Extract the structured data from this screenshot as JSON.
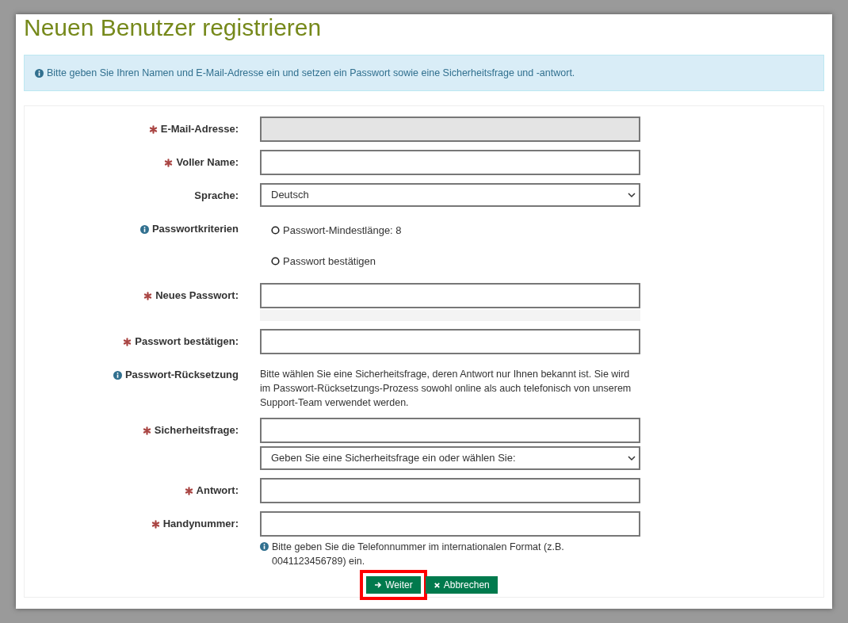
{
  "title": "Neuen Benutzer registrieren",
  "info": "Bitte geben Sie Ihren Namen und E-Mail-Adresse ein und setzen ein Passwort sowie eine Sicherheitsfrage und -antwort.",
  "fields": [
    {
      "kind": "input",
      "label": "E-Mail-Adresse:",
      "required": true,
      "disabled": true
    },
    {
      "kind": "input",
      "label": "Voller Name:",
      "required": true,
      "disabled": false
    },
    {
      "kind": "select",
      "label": "Sprache:",
      "required": false,
      "value": "Deutsch"
    },
    {
      "kind": "criteria",
      "label": "Passwortkriterien",
      "items": [
        {
          "text": "Passwort-Mindestlänge: 8",
          "checked": false
        },
        {
          "text": "Passwort bestätigen",
          "checked": false
        }
      ]
    },
    {
      "kind": "password",
      "label": "Neues Passwort:",
      "required": true,
      "disabled": false
    },
    {
      "kind": "input",
      "label": "Passwort bestätigen:",
      "required": true,
      "disabled": false
    },
    {
      "kind": "text",
      "label": "Passwort-Rücksetzung",
      "text": "Bitte wählen Sie eine Sicherheitsfrage, deren Antwort nur Ihnen bekannt ist. Sie wird im Passwort-Rücksetzungs-Prozess sowohl online als auch telefonisch von unserem Support-Team verwendet werden."
    },
    {
      "kind": "question",
      "label": "Sicherheitsfrage:",
      "required": true,
      "disabled": false,
      "select": "Geben Sie eine Sicherheitsfrage ein oder wählen Sie:"
    },
    {
      "kind": "input",
      "label": "Antwort:",
      "required": true,
      "disabled": false
    },
    {
      "kind": "hint",
      "label": "Handynummer:",
      "required": true,
      "disabled": false,
      "hint": "Bitte geben Sie die Telefonnummer im internationalen Format (z.B. 0041123456789) ein."
    }
  ],
  "buttons": [
    {
      "kind": "next",
      "label": "Weiter",
      "highlighted": true
    },
    {
      "kind": "cancel",
      "label": "Abbrechen",
      "highlighted": false
    }
  ]
}
